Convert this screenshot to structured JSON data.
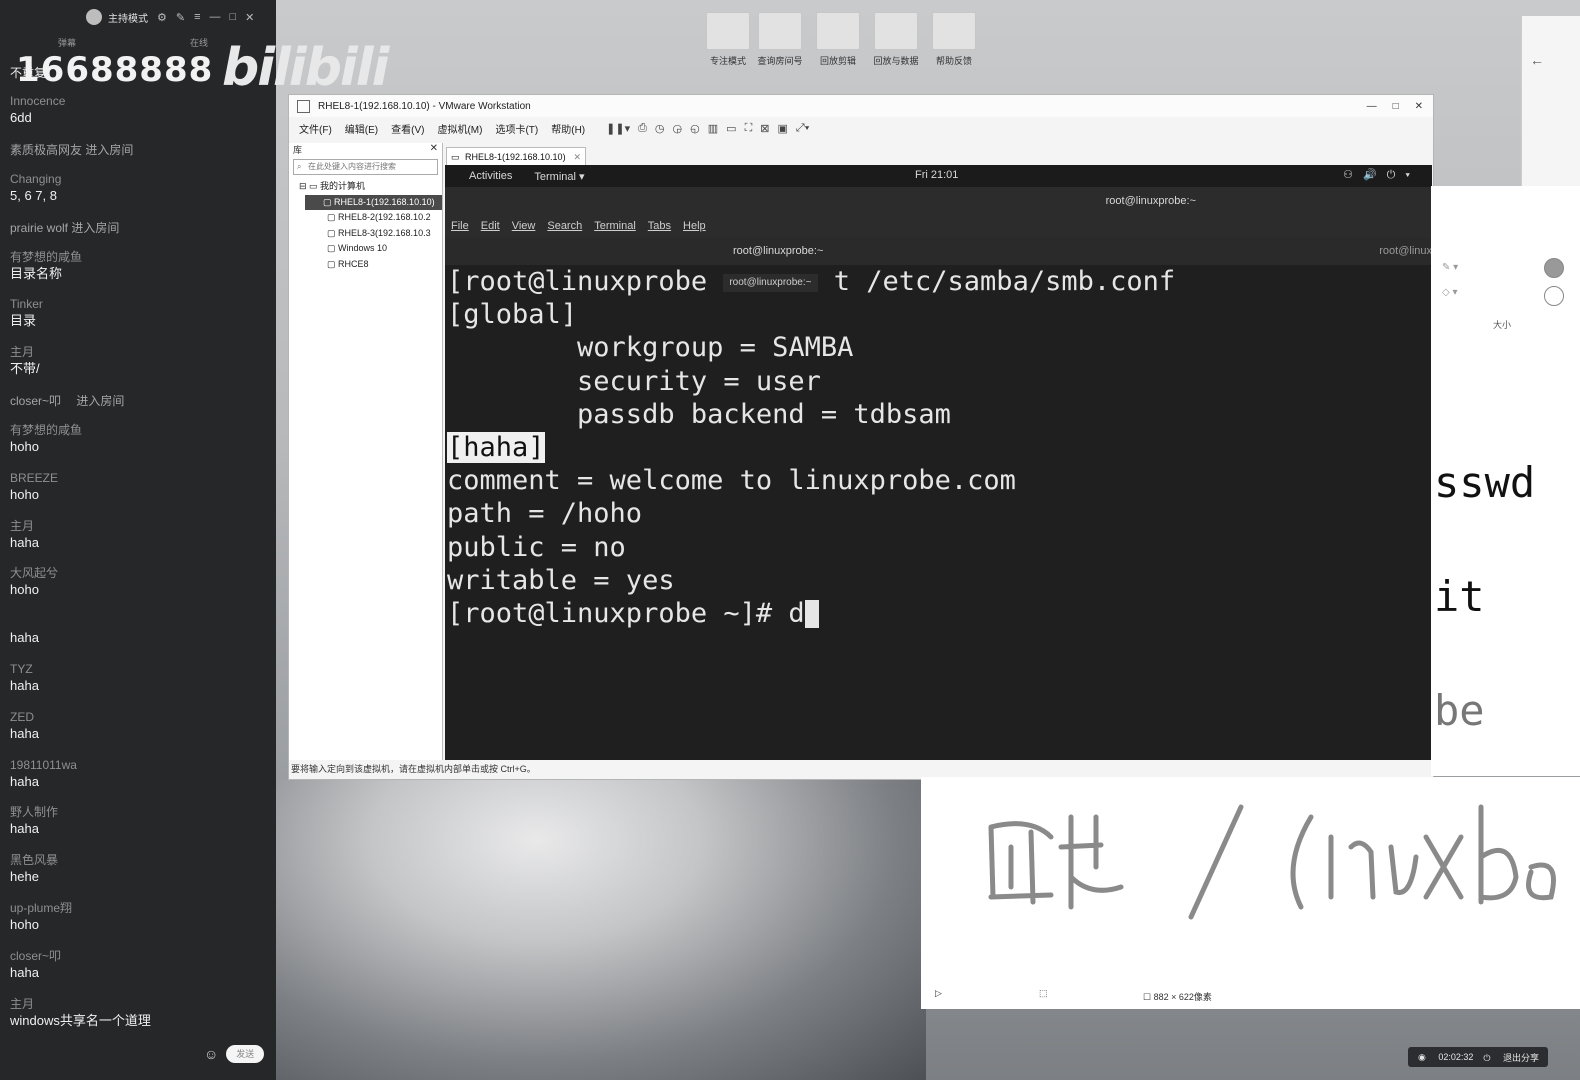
{
  "chat": {
    "mode_label": "主持模式",
    "tabs": [
      "弹幕",
      "在线"
    ],
    "banner_number": "16688888",
    "banner_logo": "bilibili",
    "first_line": "不重复",
    "messages": [
      {
        "user": "Innocence",
        "text": "6dd",
        "type": "msg"
      },
      {
        "user": "",
        "text": "素质极高网友 进入房间",
        "type": "enter"
      },
      {
        "user": "Changing",
        "text": "5, 6 7, 8",
        "type": "msg"
      },
      {
        "user": "",
        "text": "prairie wolf 进入房间",
        "type": "enter"
      },
      {
        "user": "有梦想的咸鱼",
        "text": "目录名称",
        "type": "msg"
      },
      {
        "user": "Tinker",
        "text": "目录",
        "type": "msg"
      },
      {
        "user": "主月",
        "text": "不带/",
        "type": "msg"
      },
      {
        "user": "",
        "text": "closer~叩　 进入房间",
        "type": "enter"
      },
      {
        "user": "有梦想的咸鱼",
        "text": "hoho",
        "type": "msg"
      },
      {
        "user": "BREEZE",
        "text": "hoho",
        "type": "msg"
      },
      {
        "user": "主月",
        "text": "haha",
        "type": "msg"
      },
      {
        "user": "大风起兮",
        "text": "hoho",
        "type": "msg"
      },
      {
        "user": "",
        "text": "haha",
        "type": "msg"
      },
      {
        "user": "TYZ",
        "text": "haha",
        "type": "msg"
      },
      {
        "user": "ZED",
        "text": "haha",
        "type": "msg"
      },
      {
        "user": "19811011wa",
        "text": "haha",
        "type": "msg"
      },
      {
        "user": "野人制作",
        "text": "haha",
        "type": "msg"
      },
      {
        "user": "黑色风暴",
        "text": "hehe",
        "type": "msg"
      },
      {
        "user": "up-plume翔",
        "text": "hoho",
        "type": "msg"
      },
      {
        "user": "closer~叩",
        "text": "haha",
        "type": "msg"
      },
      {
        "user": "主月",
        "text": "windows共享名一个道理",
        "type": "msg"
      }
    ],
    "send_label": "发送"
  },
  "desktop_icons": [
    "专注模式",
    "查询房间号",
    "回放剪辑",
    "回放与数据",
    "帮助反馈"
  ],
  "vmware": {
    "title": "RHEL8-1(192.168.10.10) - VMware Workstation",
    "menu": [
      "文件(F)",
      "编辑(E)",
      "查看(V)",
      "虚拟机(M)",
      "选项卡(T)",
      "帮助(H)"
    ],
    "library": {
      "header": "库",
      "search_placeholder": "在此处键入内容进行搜索",
      "root": "我的计算机",
      "items": [
        "RHEL8-1(192.168.10.10)",
        "RHEL8-2(192.168.10.2",
        "RHEL8-3(192.168.10.3",
        "Windows 10",
        "RHCE8"
      ]
    },
    "tab_label": "RHEL8-1(192.168.10.10)",
    "status": "要将输入定向到该虚拟机，请在虚拟机内部单击或按 Ctrl+G。"
  },
  "guest": {
    "activities": "Activities",
    "app_menu": "Terminal ▾",
    "clock": "Fri 21:01",
    "window_title": "root@linuxprobe:~",
    "menu": [
      "File",
      "Edit",
      "View",
      "Search",
      "Terminal",
      "Tabs",
      "Help"
    ],
    "tab1": "root@linuxprobe:~",
    "tab2": "root@linux",
    "tooltip": "root@linuxprobe:~",
    "lines": {
      "l1a": "[root@linuxprobe ",
      "l1b": " t /etc/samba/smb.conf",
      "l2": "[global]",
      "l3": "        workgroup = SAMBA",
      "l4": "        security = user",
      "l5": "        passdb backend = tdbsam",
      "l6": "[haha]",
      "l7": "comment = welcome to linuxprobe.com",
      "l8": "path = /hoho",
      "l9": "public = no",
      "l10": "writable = yes",
      "l11": "[root@linuxprobe ~]# d"
    }
  },
  "board": {
    "text1": "sswd",
    "text2": "it",
    "text3": "be",
    "size_label": "大小",
    "dims": "882 × 622像素"
  },
  "share_bar": {
    "time": "02:02:32",
    "exit": "退出分享"
  }
}
